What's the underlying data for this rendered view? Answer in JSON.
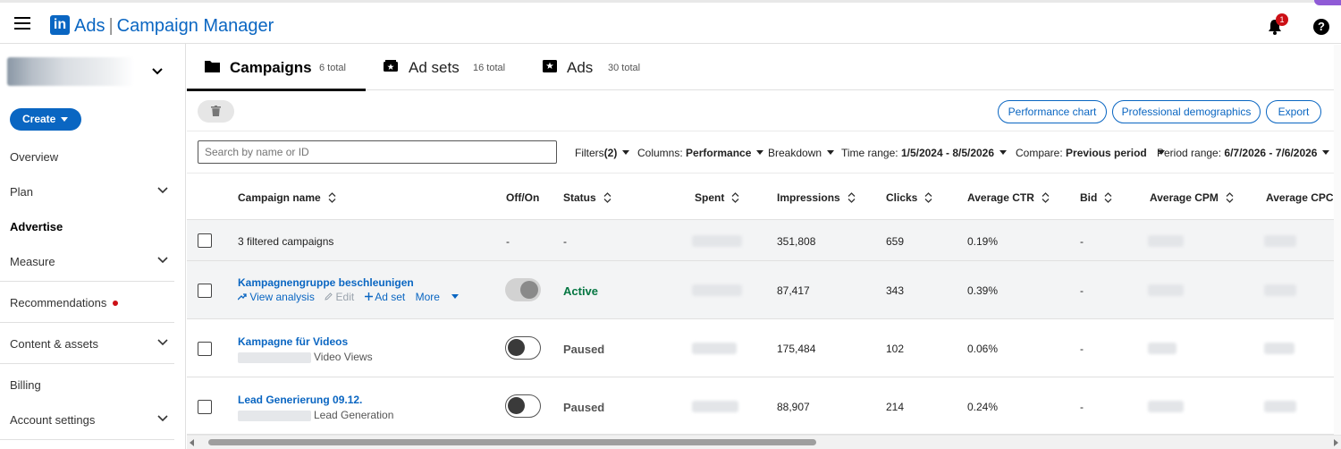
{
  "app": {
    "logo_mark": "in",
    "brand": "Ads",
    "separator": "|",
    "product": "Campaign Manager",
    "notification_count": "1",
    "help_glyph": "?"
  },
  "sidebar": {
    "create_label": "Create",
    "items": [
      {
        "label": "Overview"
      },
      {
        "label": "Plan"
      },
      {
        "label": "Advertise"
      },
      {
        "label": "Measure"
      },
      {
        "label": "Recommendations"
      },
      {
        "label": "Content & assets"
      },
      {
        "label": "Billing"
      },
      {
        "label": "Account settings"
      }
    ]
  },
  "tabs": [
    {
      "label": "Campaigns",
      "count": "6 total",
      "icon": "folder-icon"
    },
    {
      "label": "Ad sets",
      "count": "16 total",
      "icon": "ad-set-icon"
    },
    {
      "label": "Ads",
      "count": "30 total",
      "icon": "ad-icon"
    }
  ],
  "toolbar": {
    "performance_chart": "Performance chart",
    "professional_demographics": "Professional demographics",
    "export": "Export"
  },
  "filters": {
    "search_placeholder": "Search by name or ID",
    "filters_label": "Filters",
    "filters_count": "(2)",
    "columns_label": "Columns:",
    "columns_value": "Performance",
    "breakdown_label": "Breakdown",
    "time_range_label": "Time range:",
    "time_range_value": "1/5/2024 - 8/5/2026",
    "compare_label": "Compare:",
    "compare_value": "Previous period",
    "period_range_label": "Period range:",
    "period_range_value": "6/7/2026 - 7/6/2026"
  },
  "table": {
    "headers": {
      "campaign_name": "Campaign name",
      "off_on": "Off/On",
      "status": "Status",
      "spent": "Spent",
      "impressions": "Impressions",
      "clicks": "Clicks",
      "avg_ctr": "Average CTR",
      "bid": "Bid",
      "avg_cpm": "Average CPM",
      "avg_cpc": "Average CPC"
    },
    "summary": {
      "label": "3 filtered campaigns",
      "off_on": "-",
      "status": "-",
      "impressions": "351,808",
      "clicks": "659",
      "ctr": "0.19%",
      "bid": "-"
    },
    "rows": [
      {
        "name": "Kampagnengruppe beschleunigen",
        "actions": {
          "view_analysis": "View analysis",
          "edit": "Edit",
          "ad_set": "Ad set",
          "more": "More"
        },
        "status": "Active",
        "status_color": "#057642",
        "toggle": "on",
        "impressions": "87,417",
        "clicks": "343",
        "ctr": "0.39%",
        "bid": "-"
      },
      {
        "name": "Kampagne für Videos",
        "subtitle": "Video Views",
        "status": "Paused",
        "status_color": "#555555",
        "toggle": "off",
        "impressions": "175,484",
        "clicks": "102",
        "ctr": "0.06%",
        "bid": "-"
      },
      {
        "name": "Lead Generierung 09.12.",
        "subtitle": "Lead Generation",
        "status": "Paused",
        "status_color": "#555555",
        "toggle": "off",
        "impressions": "88,907",
        "clicks": "214",
        "ctr": "0.24%",
        "bid": "-"
      }
    ]
  },
  "colors": {
    "brand_blue": "#0a66c2",
    "active_green": "#057642",
    "alert_red": "#cc1016"
  }
}
